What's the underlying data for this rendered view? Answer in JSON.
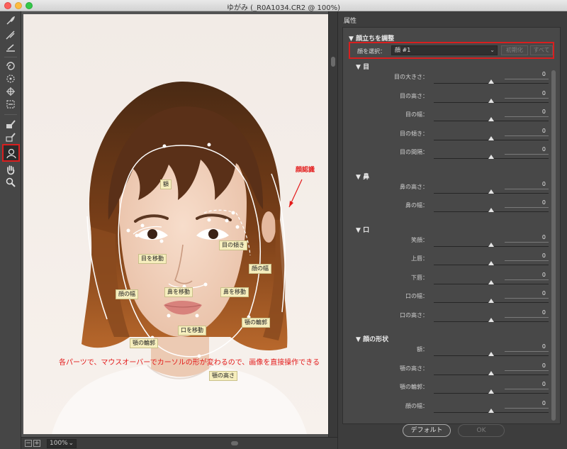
{
  "window": {
    "title": "ゆがみ (_R0A1034.CR2 @ 100%)"
  },
  "tools": [
    {
      "icon": "forward-warp-icon"
    },
    {
      "icon": "reconstruct-icon"
    },
    {
      "icon": "smooth-icon"
    },
    {
      "icon": "twirl-icon"
    },
    {
      "icon": "pucker-icon"
    },
    {
      "icon": "bloat-icon"
    },
    {
      "icon": "push-left-icon"
    },
    {
      "icon": "freeze-mask-icon"
    },
    {
      "icon": "thaw-mask-icon"
    },
    {
      "icon": "face-tool-icon",
      "selected": true
    },
    {
      "icon": "hand-icon"
    },
    {
      "icon": "zoom-icon"
    }
  ],
  "canvas": {
    "zoom": "100%",
    "labels": {
      "forehead": "額",
      "eye_tilt": "目の傾き",
      "eye_move": "目を移動",
      "face_width_right": "顔の幅",
      "face_width_left": "顔の幅",
      "nose_move": "鼻を移動",
      "nose_height": "鼻を移動",
      "mouth_move": "口を移動",
      "jaw_contour_right": "顎の輪郭",
      "jaw_contour_left": "顎の輪郭",
      "chin_height": "顎の高さ"
    },
    "face_recognition_note": "顔認識",
    "caption": "各パーツで、マウスオーバーでカーソルの形が変わるので、画像を直接操作できる"
  },
  "panel": {
    "header": "属性",
    "section": "顔立ちを調整",
    "face_select_label": "顔を選択：",
    "face_select_value": "顔 #1",
    "reset_button": "初期化",
    "all_button": "すべて",
    "groups": [
      {
        "title": "目",
        "params": [
          {
            "label": "目の大きさ：",
            "value": "0"
          },
          {
            "label": "目の高さ：",
            "value": "0"
          },
          {
            "label": "目の幅：",
            "value": "0"
          },
          {
            "label": "目の傾き：",
            "value": "0"
          },
          {
            "label": "目の間隔：",
            "value": "0"
          }
        ]
      },
      {
        "title": "鼻",
        "params": [
          {
            "label": "鼻の高さ：",
            "value": "0"
          },
          {
            "label": "鼻の幅：",
            "value": "0"
          }
        ]
      },
      {
        "title": "口",
        "params": [
          {
            "label": "笑顔：",
            "value": "0"
          },
          {
            "label": "上唇：",
            "value": "0"
          },
          {
            "label": "下唇：",
            "value": "0"
          },
          {
            "label": "口の幅：",
            "value": "0"
          },
          {
            "label": "口の高さ：",
            "value": "0"
          }
        ]
      },
      {
        "title": "顔の形状",
        "params": [
          {
            "label": "額：",
            "value": "0"
          },
          {
            "label": "顎の高さ：",
            "value": "0"
          },
          {
            "label": "顎の輪郭：",
            "value": "0"
          },
          {
            "label": "顔の幅：",
            "value": "0"
          }
        ]
      }
    ]
  },
  "buttons": {
    "default": "デフォルト",
    "ok": "OK"
  }
}
